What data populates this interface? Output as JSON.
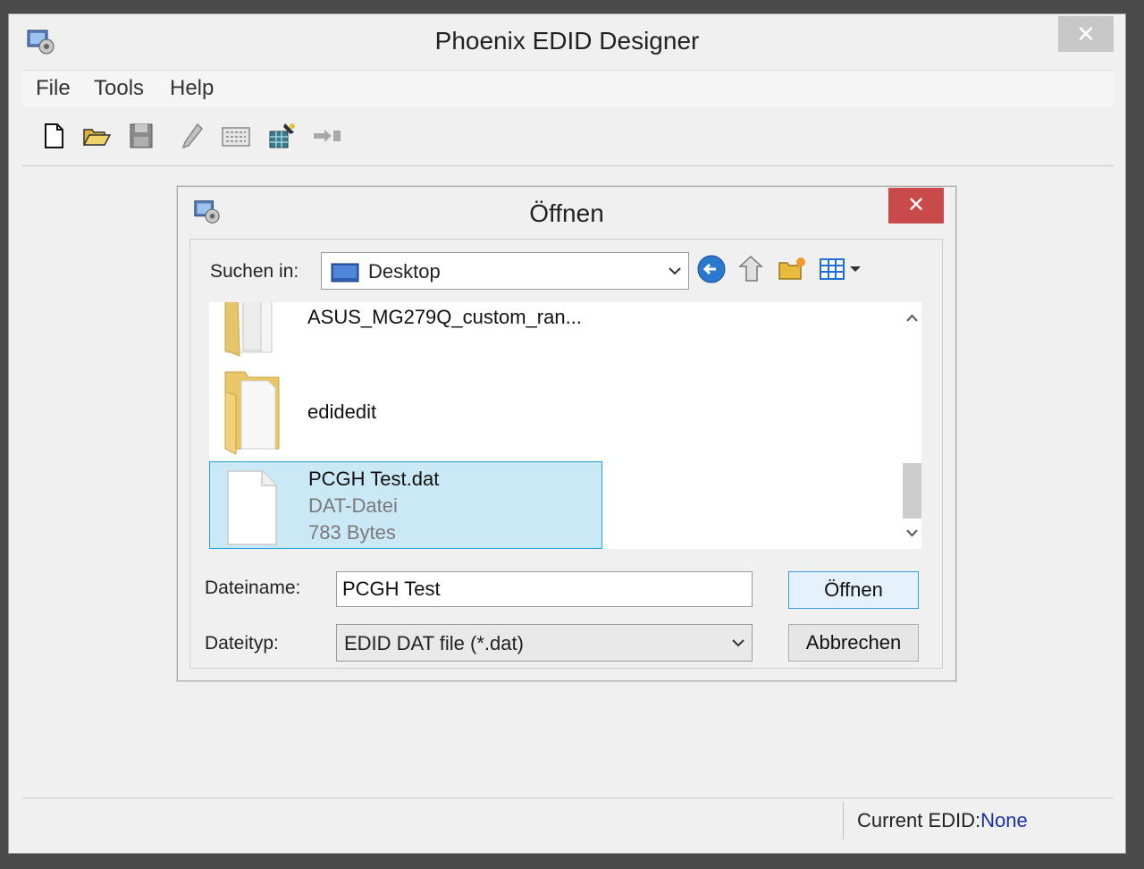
{
  "window": {
    "title": "Phoenix EDID Designer",
    "close_label": "✕"
  },
  "menu": {
    "items": [
      "File",
      "Tools",
      "Help"
    ]
  },
  "toolbar": {
    "buttons": [
      "new-file-icon",
      "open-folder-icon",
      "save-icon",
      "edit-pencil-icon",
      "keyboard-icon",
      "grid-wizard-icon",
      "arrow-export-icon"
    ]
  },
  "status": {
    "label": "Current EDID:",
    "value": "None"
  },
  "dialog": {
    "title": "Öffnen",
    "close_label": "✕",
    "lookin_label": "Suchen in:",
    "lookin_value": "Desktop",
    "nav_icons": [
      "back-arrow-icon",
      "up-folder-icon",
      "new-folder-icon",
      "view-menu-icon"
    ],
    "files": [
      {
        "name": "ASUS_MG279Q_custom_ran...",
        "type": "folder"
      },
      {
        "name": "edidedit",
        "type": "folder"
      },
      {
        "name": "PCGH Test.dat",
        "kind": "DAT-Datei",
        "size": "783 Bytes",
        "type": "file",
        "selected": true
      }
    ],
    "filename_label": "Dateiname:",
    "filename_value": "PCGH Test",
    "filetype_label": "Dateityp:",
    "filetype_value": "EDID DAT file (*.dat)",
    "open_button": "Öffnen",
    "cancel_button": "Abbrechen"
  },
  "colors": {
    "selection_bg": "#cbe8f6",
    "selection_border": "#26a0da",
    "close_red": "#c94a4a",
    "status_value": "#1a2fa6"
  }
}
